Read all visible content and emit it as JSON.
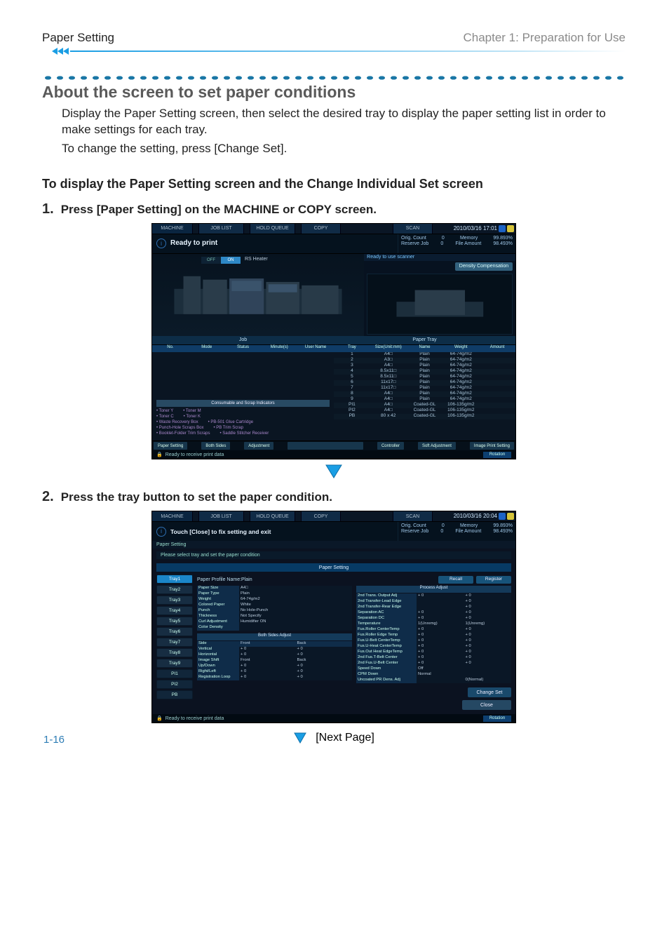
{
  "header": {
    "left": "Paper Setting",
    "right": "Chapter 1: Preparation for Use"
  },
  "section": {
    "title": "About the screen to set paper conditions",
    "para1": "Display the Paper Setting screen, then select the desired tray to display the paper setting list in order to make settings for each tray.",
    "para2": "To change the setting, press [Change Set]."
  },
  "procedure": {
    "title": "To display the Paper Setting screen and the Change Individual Set screen",
    "steps": [
      {
        "num": "1.",
        "text": "Press [Paper Setting] on the MACHINE or COPY screen."
      },
      {
        "num": "2.",
        "text": "Press the tray button to set the paper condition."
      }
    ]
  },
  "screen1": {
    "tabs": {
      "machine": "MACHINE",
      "joblist": "JOB LIST",
      "recall": "HOLD QUEUE",
      "copy": "COPY",
      "scan": "SCAN"
    },
    "clock": "2010/03/16 17:01",
    "status_main": "Ready to print",
    "status_right": {
      "r1a": "Orig. Count",
      "r1b": "0",
      "r1c": "Memory",
      "r1d": "99.893%",
      "r2a": "Reserve Job",
      "r2b": "0",
      "r2c": "File Amount",
      "r2d": "98.493%"
    },
    "rs_toggle_on": "ON",
    "rs_toggle_off": "OFF",
    "rs_label": "RS Heater",
    "right_banner": "Ready to use scanner",
    "right_button": "Density Compensation",
    "mid_left": "Job",
    "mid_right": "Paper Tray",
    "job_headers": [
      "No.",
      "Mode",
      "Status",
      "Minute(s)",
      "User Name"
    ],
    "tray_headers": [
      "Tray",
      "Size(Unit:mm)",
      "Name",
      "Weight",
      "Amount"
    ],
    "tray_rows": [
      [
        "1",
        "A4□",
        "Plain",
        "64-74g/m2",
        ""
      ],
      [
        "2",
        "A3□",
        "Plain",
        "64-74g/m2",
        ""
      ],
      [
        "3",
        "A4□",
        "Plain",
        "64-74g/m2",
        ""
      ],
      [
        "4",
        "8.5x11□",
        "Plain",
        "64-74g/m2",
        ""
      ],
      [
        "5",
        "8.5x11□",
        "Plain",
        "64-74g/m2",
        ""
      ],
      [
        "6",
        "11x17□",
        "Plain",
        "64-74g/m2",
        ""
      ],
      [
        "7",
        "11x17□",
        "Plain",
        "64-74g/m2",
        ""
      ],
      [
        "8",
        "A4□",
        "Plain",
        "64-74g/m2",
        ""
      ],
      [
        "9",
        "A4□",
        "Plain",
        "64-74g/m2",
        ""
      ],
      [
        "PI1",
        "A4□",
        "Coated-GL",
        "106-135g/m2",
        ""
      ],
      [
        "PI2",
        "A4□",
        "Coated-GL",
        "106-135g/m2",
        ""
      ],
      [
        "PB",
        "80 x 42",
        "Coated-GL",
        "106-135g/m2",
        ""
      ]
    ],
    "consum_label": "Consumable and Scrap Indicators",
    "consum_items": [
      [
        "Toner Y",
        "Toner M"
      ],
      [
        "Toner C",
        "Toner K"
      ],
      [
        "Waste Recovery Box",
        "PB-501 Glue Cartridge"
      ],
      [
        "Punch-Hole Scraps Box",
        "PB Trim Scrap"
      ],
      [
        "Booklet-Folder Trim Scraps",
        "Saddle Stitcher Receiver"
      ]
    ],
    "bottom_buttons": [
      "Paper Setting",
      "Both Sides",
      "Adjustment",
      "",
      "Controller",
      "Soft Adjustment",
      "Image Print Setting"
    ],
    "footer": "Ready to receive print data",
    "rotation": "Rotation"
  },
  "screen2": {
    "clock": "2010/03/16 20:04",
    "status_main": "Touch [Close] to fix setting and exit",
    "breadcrumb": "Paper Setting",
    "instruction": "Please select tray and set the paper condition",
    "teal_title": "Paper Setting",
    "trays": [
      "Tray1",
      "Tray2",
      "Tray3",
      "Tray4",
      "Tray5",
      "Tray6",
      "Tray7",
      "Tray8",
      "Tray9",
      "PI1",
      "PI2",
      "PB"
    ],
    "profile_label": "Paper Profile Name:Plain",
    "btn_recall": "Recall",
    "btn_register": "Register",
    "left_kv": [
      [
        "Paper Size",
        "A4□"
      ],
      [
        "Paper Type",
        "Plain"
      ],
      [
        "Weight",
        "64-74g/m2"
      ],
      [
        "Colored Paper",
        "White"
      ],
      [
        "Punch",
        "No Hole-Punch"
      ],
      [
        "Thickness",
        "Not Specify"
      ],
      [
        "Curl Adjustment",
        "Humidifier ON"
      ],
      [
        "Color Density",
        ""
      ]
    ],
    "both_sides_label": "Both Sides Adjust",
    "both_sides_hdr": [
      "Side",
      "Front",
      "Back"
    ],
    "both_sides_rows": [
      [
        "Vertical",
        "+ 0",
        "+ 0"
      ],
      [
        "Horizontal",
        "+ 0",
        "+ 0"
      ],
      [
        "Image Shift",
        "Front",
        "Back"
      ],
      [
        "Up/Down",
        "+ 0",
        "+ 0"
      ],
      [
        "Right/Left",
        "+ 0",
        "+ 0"
      ],
      [
        "Registration Loop",
        "+ 0",
        "+ 0"
      ]
    ],
    "right_hdr": "Process Adjust",
    "right_rows": [
      [
        "2nd Trans. Output Adj",
        "+ 0",
        "+ 0"
      ],
      [
        "2nd Transfer-Lead Edge",
        "",
        "+ 0"
      ],
      [
        "2nd Transfer-Rear Edge",
        "",
        "+ 0"
      ],
      [
        "Separation AC",
        "+ 0",
        "+ 0"
      ],
      [
        "Separation DC",
        "+ 0",
        "+ 0"
      ],
      [
        "Temperature",
        "1(Unremg)",
        "1(Unremg)"
      ],
      [
        "Fus.Roller CenterTemp",
        "+ 0",
        "+ 0"
      ],
      [
        "Fus.Roller Edge Temp",
        "+ 0",
        "+ 0"
      ],
      [
        "Fus.U-Belt CenterTemp",
        "+ 0",
        "+ 0"
      ],
      [
        "Fus.U-Heat CenterTemp",
        "+ 0",
        "+ 0"
      ],
      [
        "Fus.Out Heat EdgeTemp",
        "+ 0",
        "+ 0"
      ],
      [
        "2nd Fus.T-Belt Center",
        "+ 0",
        "+ 0"
      ],
      [
        "2nd Fus.U-Belt Center",
        "+ 0",
        "+ 0"
      ],
      [
        "Speed Down",
        "Off",
        ""
      ],
      [
        "CPM Down",
        "Normal",
        ""
      ],
      [
        "Uncoated PR Dens. Adj",
        "",
        "0(Normal)"
      ]
    ],
    "btn_change": "Change Set",
    "btn_close": "Close",
    "footer": "Ready to receive print data",
    "rotation": "Rotation"
  },
  "next_page": "[Next Page]",
  "page_number": "1-16"
}
